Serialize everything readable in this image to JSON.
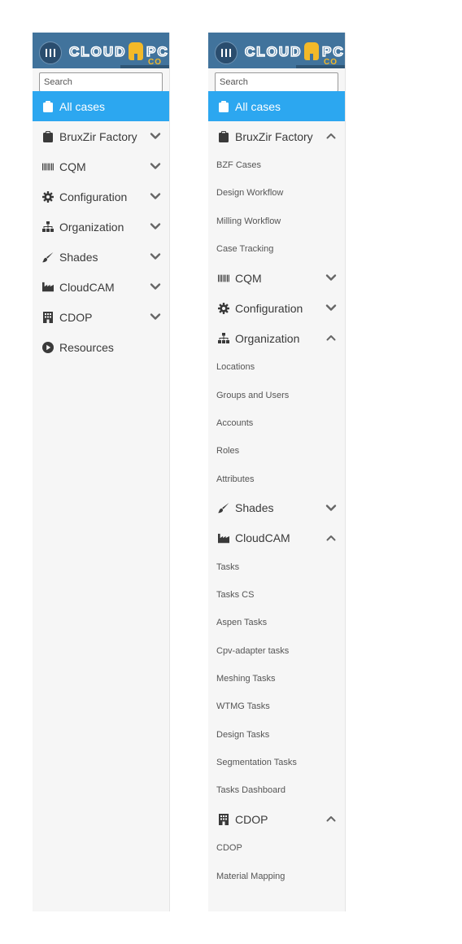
{
  "search": {
    "placeholder": "Search"
  },
  "left_panel": {
    "items": [
      {
        "label": "All cases",
        "icon": "clipboard-icon",
        "active": true
      },
      {
        "label": "BruxZir Factory",
        "icon": "clipboard-icon",
        "expanded": false
      },
      {
        "label": "CQM",
        "icon": "barcode-icon",
        "expanded": false
      },
      {
        "label": "Configuration",
        "icon": "gear-icon",
        "expanded": false
      },
      {
        "label": "Organization",
        "icon": "sitemap-icon",
        "expanded": false
      },
      {
        "label": "Shades",
        "icon": "brush-icon",
        "expanded": false
      },
      {
        "label": "CloudCAM",
        "icon": "factory-icon",
        "expanded": false
      },
      {
        "label": "CDOP",
        "icon": "building-icon",
        "expanded": false
      },
      {
        "label": "Resources",
        "icon": "play-circle-icon"
      }
    ]
  },
  "right_panel": {
    "all_cases": "All cases",
    "bruxzir": {
      "label": "BruxZir Factory",
      "subs": [
        "BZF Cases",
        "Design Workflow",
        "Milling Workflow",
        "Case Tracking"
      ]
    },
    "cqm": {
      "label": "CQM"
    },
    "configuration": {
      "label": "Configuration"
    },
    "organization": {
      "label": "Organization",
      "subs": [
        "Locations",
        "Groups and Users",
        "Accounts",
        "Roles",
        "Attributes"
      ]
    },
    "shades": {
      "label": "Shades"
    },
    "cloudcam": {
      "label": "CloudCAM",
      "subs": [
        "Tasks",
        "Tasks CS",
        "Aspen Tasks",
        "Cpv-adapter tasks",
        "Meshing Tasks",
        "WTMG Tasks",
        "Design Tasks",
        "Segmentation Tasks",
        "Tasks Dashboard"
      ]
    },
    "cdop": {
      "label": "CDOP",
      "subs": [
        "CDOP",
        "Material Mapping"
      ]
    }
  },
  "colors": {
    "active": "#2ca7f0",
    "header": "#41739c",
    "accent": "#f3b928",
    "panel": "#f6f6f6"
  }
}
